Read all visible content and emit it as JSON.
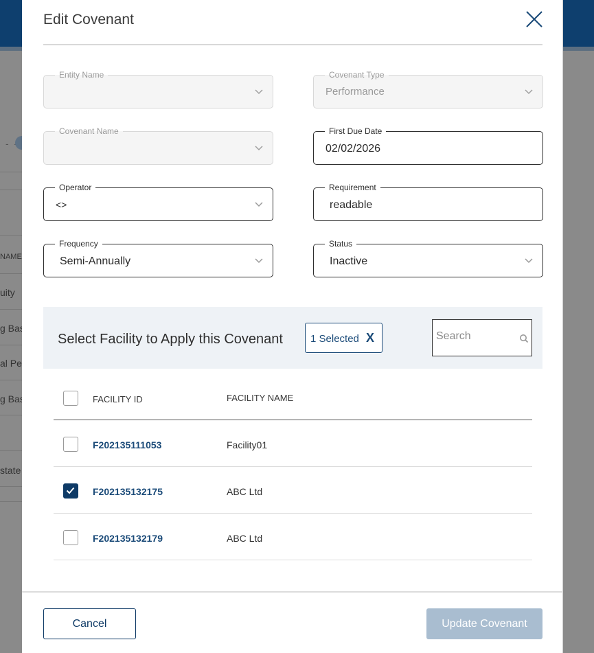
{
  "background": {
    "rows": [
      "NAME",
      "uity",
      "g Bas",
      "al Pe",
      "g Bas",
      "state"
    ]
  },
  "modal": {
    "title": "Edit Covenant",
    "close_icon": "close-icon"
  },
  "form": {
    "entity_name": {
      "label": "Entity Name",
      "value": ""
    },
    "covenant_type": {
      "label": "Covenant Type",
      "value": "Performance"
    },
    "covenant_name": {
      "label": "Covenant Name",
      "value": ""
    },
    "first_due_date": {
      "label": "First Due Date",
      "value": "02/02/2026"
    },
    "operator": {
      "label": "Operator",
      "value": "<>"
    },
    "requirement": {
      "label": "Requirement",
      "value": "readable"
    },
    "frequency": {
      "label": "Frequency",
      "value": "Semi-Annually"
    },
    "status": {
      "label": "Status",
      "value": "Inactive"
    }
  },
  "facility": {
    "title": "Select Facility to Apply this Covenant",
    "selected_label": "1 Selected",
    "clear_label": "X",
    "search_placeholder": "Search",
    "columns": {
      "id": "FACILITY ID",
      "name": "FACILITY NAME"
    },
    "rows": [
      {
        "id": "F202135111053",
        "name": "Facility01",
        "checked": false
      },
      {
        "id": "F202135132175",
        "name": "ABC Ltd",
        "checked": true
      },
      {
        "id": "F202135132179",
        "name": "ABC Ltd",
        "checked": false
      }
    ]
  },
  "footer": {
    "cancel_label": "Cancel",
    "update_label": "Update Covenant"
  },
  "colors": {
    "primary": "#0e3a66",
    "link": "#1a4a78",
    "disabled_button": "#a9bdd0",
    "panel_bg": "#eef2f6"
  }
}
